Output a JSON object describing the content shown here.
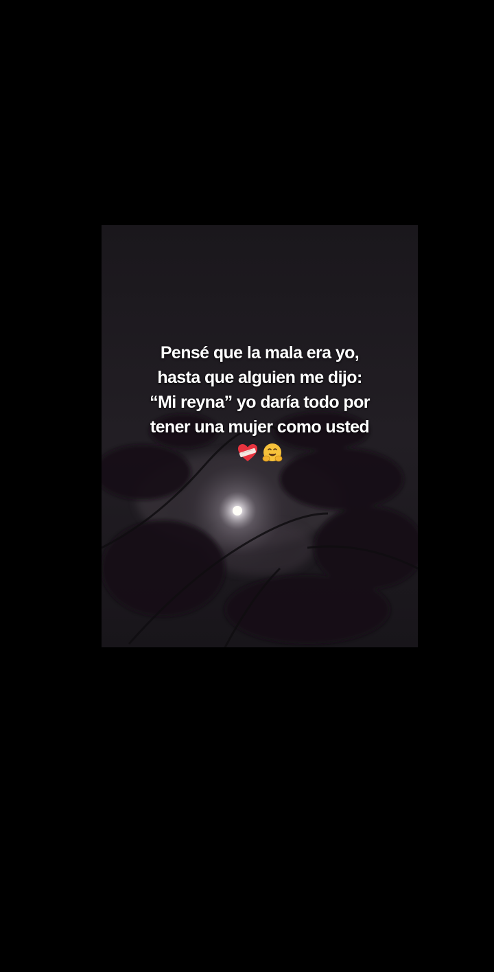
{
  "caption": {
    "lines": [
      "Pensé que la mala era yo,",
      "hasta que alguien me dijo:",
      "“Mi reyna” yo daría todo por",
      "tener una mujer como usted"
    ],
    "emojis": [
      "mending-heart-icon",
      "hugging-face-icon"
    ]
  },
  "colors": {
    "background": "#000000",
    "photo_base": "#1b181d",
    "text": "#ffffff",
    "heart": "#e8343f",
    "hug_face": "#f7c23b"
  }
}
